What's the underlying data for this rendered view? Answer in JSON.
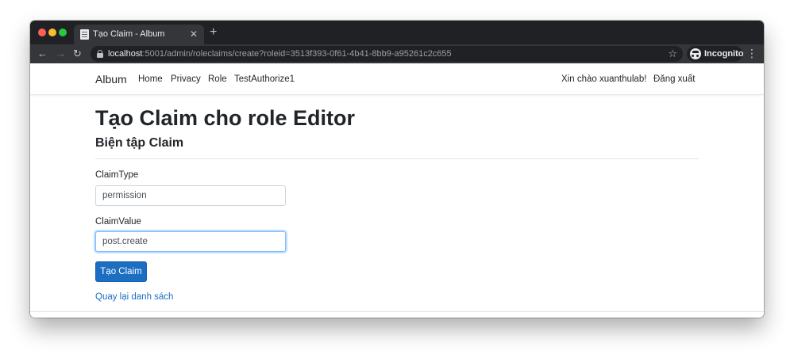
{
  "browser": {
    "tab_title": "Tạo Claim - Album",
    "url_host": "localhost",
    "url_rest": ":5001/admin/roleclaims/create?roleid=3513f393-0f61-4b41-8bb9-a95261c2c655",
    "profile_label": "Incognito"
  },
  "navbar": {
    "brand": "Album",
    "links": [
      "Home",
      "Privacy",
      "Role",
      "TestAuthorize1"
    ],
    "greeting": "Xin chào xuanthulab!",
    "logout": "Đăng xuất"
  },
  "main": {
    "title": "Tạo Claim cho role Editor",
    "subtitle": "Biện tập Claim",
    "claim_type_label": "ClaimType",
    "claim_type_value": "permission",
    "claim_value_label": "ClaimValue",
    "claim_value_value": "post.create",
    "submit_label": "Tạo Claim",
    "back_link": "Quay lại danh sách"
  },
  "colors": {
    "primary": "#1b6ec2",
    "chrome_dark": "#202124",
    "chrome_toolbar": "#35363a"
  }
}
